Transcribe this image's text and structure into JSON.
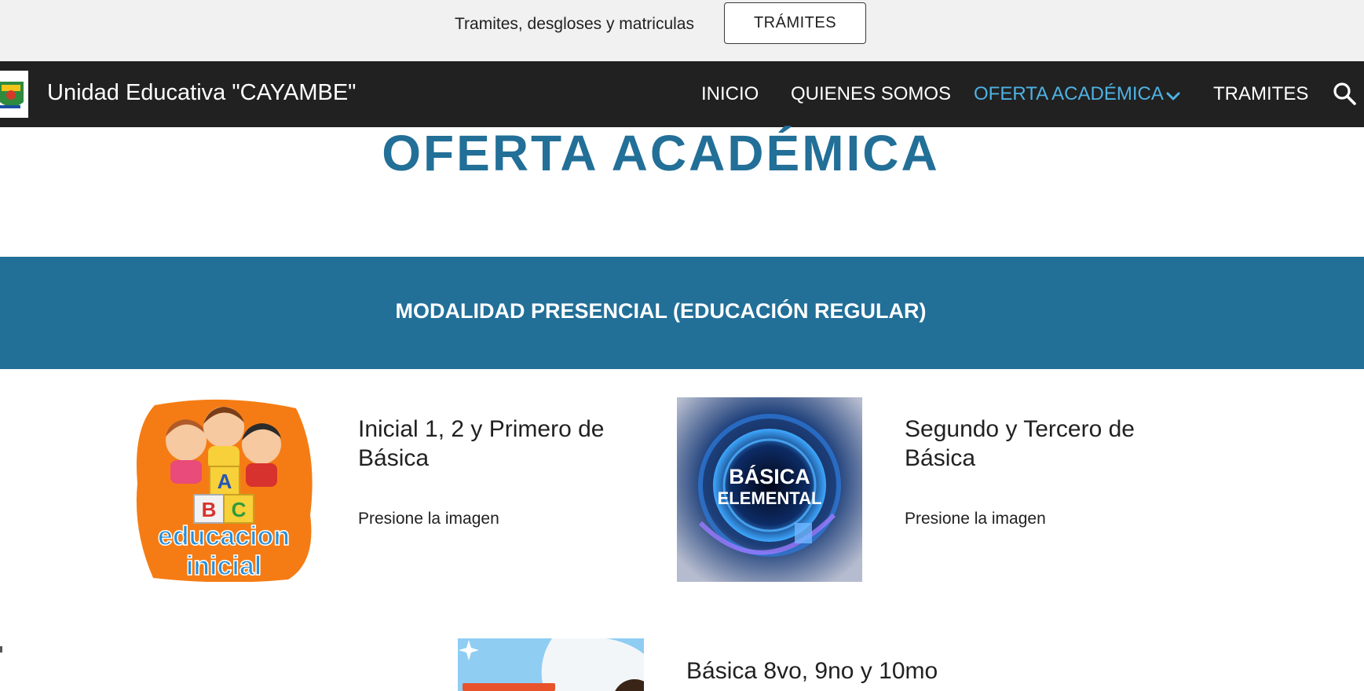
{
  "announcement": {
    "text": "Tramites, desgloses y matriculas",
    "button_label": "TRÁMITES"
  },
  "header": {
    "site_title": "Unidad Educativa \"CAYAMBE\"",
    "nav": [
      {
        "label": "INICIO",
        "active": false
      },
      {
        "label": "QUIENES SOMOS",
        "active": false
      },
      {
        "label": "OFERTA ACADÉMICA",
        "active": true
      },
      {
        "label": "TRAMITES",
        "active": false
      }
    ],
    "icons": {
      "chevron": "chevron-down-icon",
      "search": "search-icon"
    },
    "active_color": "#4fb2e4"
  },
  "page": {
    "title": "OFERTA ACADÉMICA"
  },
  "band": {
    "title": "MODALIDAD PRESENCIAL (EDUCACIÓN REGULAR)",
    "color": "#226f98"
  },
  "tiles": [
    {
      "heading": "Inicial 1, 2 y Primero de Básica",
      "hint": "Presione la imagen",
      "image_text": [
        "A",
        "B",
        "C",
        "educacion",
        "inicial"
      ]
    },
    {
      "heading": "Segundo y Tercero de Básica",
      "hint": "Presione la imagen",
      "image_text": [
        "BÁSICA",
        "ELEMENTAL"
      ]
    },
    {
      "heading": "Básica 8vo, 9no y 10mo",
      "hint": "",
      "image_text": []
    }
  ]
}
